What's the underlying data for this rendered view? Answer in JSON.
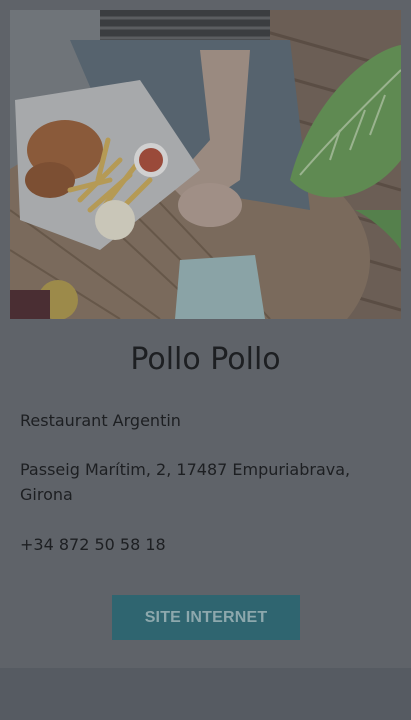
{
  "restaurant": {
    "name": "Pollo Pollo",
    "category": "Restaurant Argentin",
    "address": "Passeig Marítim, 2, 17487 Empuriabrava, Girona",
    "phone": "+34 872 50 58 18",
    "website_button": "SITE INTERNET"
  },
  "colors": {
    "overlay": "#5f6369",
    "button_bg": "#2f6570",
    "button_text": "#8da8ad",
    "text": "#1d1f22"
  }
}
